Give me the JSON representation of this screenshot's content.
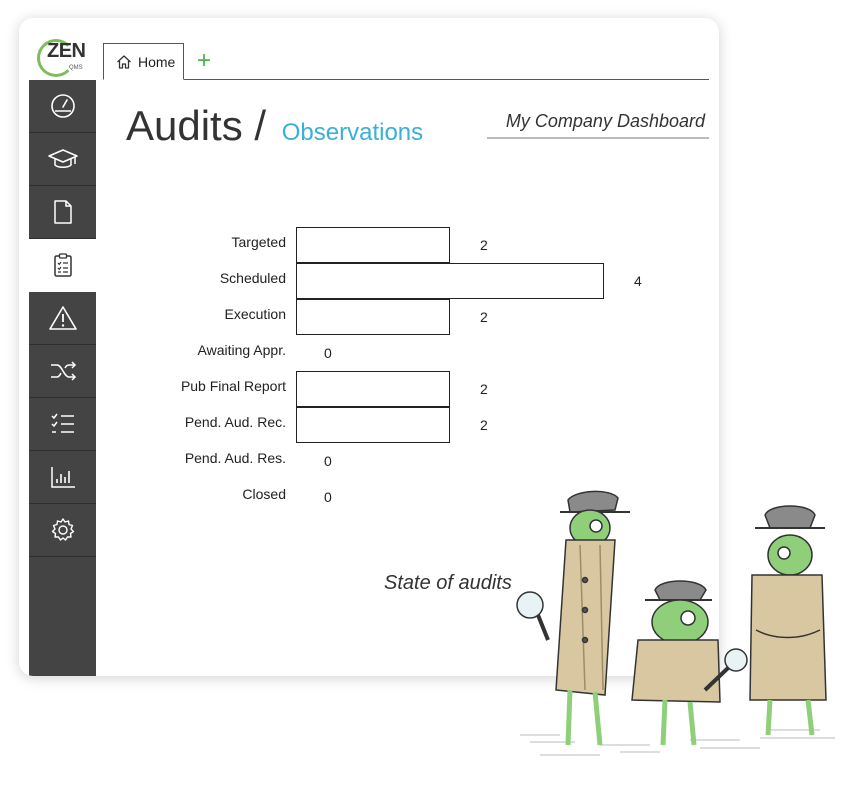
{
  "logo": {
    "text": "ZEN",
    "sub": "QMS"
  },
  "tabs": [
    {
      "label": "Home",
      "icon": "home-icon"
    }
  ],
  "add_tab_symbol": "+",
  "sidebar": {
    "items": [
      {
        "icon": "dashboard-gauge-icon"
      },
      {
        "icon": "graduation-cap-icon"
      },
      {
        "icon": "document-icon"
      },
      {
        "icon": "clipboard-checklist-icon",
        "active": true
      },
      {
        "icon": "warning-triangle-icon"
      },
      {
        "icon": "shuffle-icon"
      },
      {
        "icon": "checklist-icon"
      },
      {
        "icon": "bar-chart-icon"
      },
      {
        "icon": "gear-icon"
      }
    ]
  },
  "page": {
    "title": "Audits /",
    "subtitle": "Observations",
    "dashboard_link": "My Company Dashboard"
  },
  "chart_data": {
    "type": "bar",
    "orientation": "horizontal",
    "title": "State of audits",
    "categories": [
      "Targeted",
      "Scheduled",
      "Execution",
      "Awaiting Appr.",
      "Pub Final Report",
      "Pend. Aud. Rec.",
      "Pend. Aud. Res.",
      "Closed"
    ],
    "values": [
      2,
      4,
      2,
      0,
      2,
      2,
      0,
      0
    ],
    "xlim": [
      0,
      4
    ],
    "grid": false,
    "legend": "none",
    "bar_color": "#ffffff",
    "bar_edge_color": "#222222"
  },
  "colors": {
    "sidebar_bg": "#444444",
    "accent_blue": "#3ab0d6",
    "accent_green": "#7dbd5a"
  }
}
